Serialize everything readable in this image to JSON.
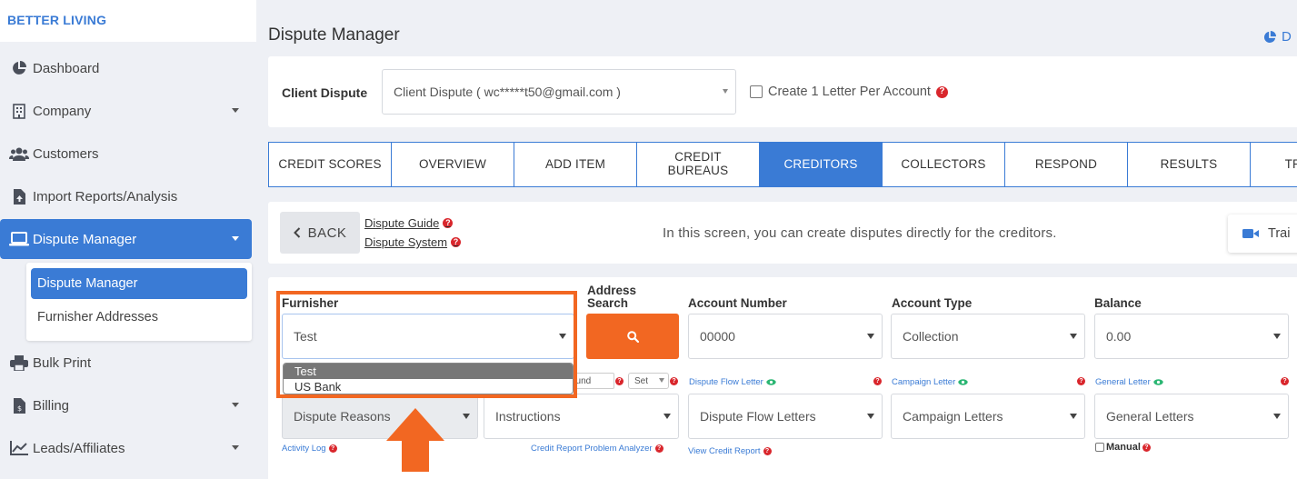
{
  "brand": "BETTER LIVING",
  "sidebar": {
    "items": [
      {
        "label": "Dashboard",
        "icon": "pie-chart-icon"
      },
      {
        "label": "Company",
        "icon": "building-icon"
      },
      {
        "label": "Customers",
        "icon": "users-icon"
      },
      {
        "label": "Import Reports/Analysis",
        "icon": "file-upload-icon"
      },
      {
        "label": "Dispute Manager",
        "icon": "laptop-icon"
      },
      {
        "label": "Bulk Print",
        "icon": "printer-icon"
      },
      {
        "label": "Billing",
        "icon": "invoice-icon"
      },
      {
        "label": "Leads/Affiliates",
        "icon": "line-chart-icon"
      }
    ],
    "submenu": [
      "Dispute Manager",
      "Furnisher Addresses"
    ]
  },
  "page_title": "Dispute Manager",
  "top_right_link": "D",
  "client": {
    "label": "Client Dispute",
    "select_value": "Client Dispute ( wc*****t50@gmail.com )",
    "create_letter_label": "Create 1 Letter Per Account"
  },
  "tabs": [
    "CREDIT SCORES",
    "OVERVIEW",
    "ADD ITEM",
    "CREDIT BUREAUS",
    "CREDITORS",
    "COLLECTORS",
    "RESPOND",
    "RESULTS",
    "TR"
  ],
  "info": {
    "back_label": "BACK",
    "guide_link": "Dispute Guide",
    "system_link": "Dispute System",
    "text": "In this screen, you can create disputes directly for the creditors.",
    "training_label": "Trai"
  },
  "form": {
    "furnisher_label": "Furnisher",
    "furnisher_value": "Test",
    "furnisher_options": [
      "Test",
      "US Bank"
    ],
    "address_search_label_1": "Address",
    "address_search_label_2": "Search",
    "account_number_label": "Account Number",
    "account_number_value": "00000",
    "account_type_label": "Account Type",
    "account_type_value": "Collection",
    "balance_label": "Balance",
    "balance_value": "0.00",
    "small_round_value": "ound",
    "set_value": "Set",
    "dfl_label": "Dispute Flow Letter",
    "campaign_label": "Campaign Letter",
    "general_label": "General Letter",
    "reasons_value": "Dispute Reasons",
    "instructions_value": "Instructions",
    "dfl_value": "Dispute Flow Letters",
    "campaign_value": "Campaign Letters",
    "general_value": "General Letters",
    "activity_log": "Activity Log",
    "analyzer_link": "Credit Report Problem Analyzer",
    "view_report": "View Credit Report",
    "manual_label": "Manual"
  },
  "colors": {
    "primary": "#3a7bd5",
    "accent": "#f26722",
    "danger": "#d9262c"
  }
}
